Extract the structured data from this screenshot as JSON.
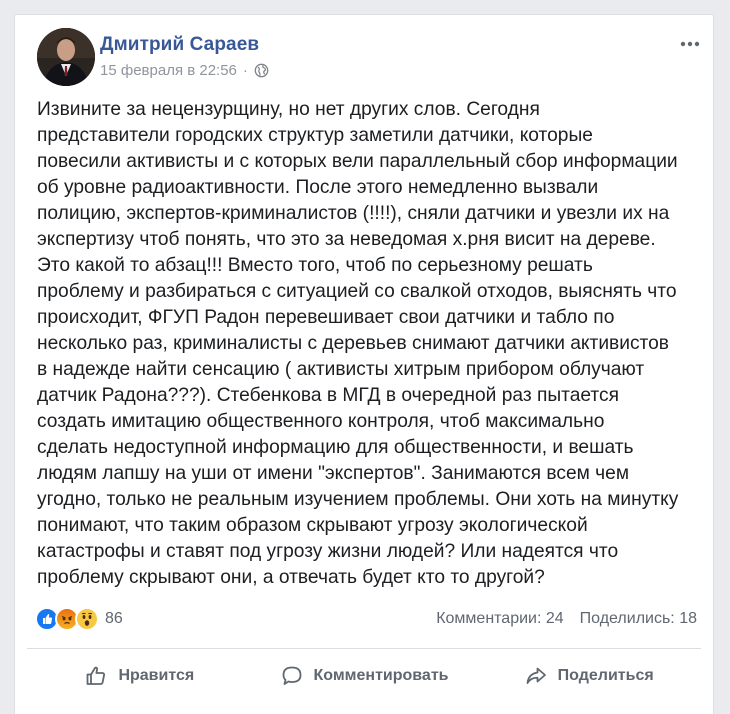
{
  "post": {
    "author": "Дмитрий Сараев",
    "date": "15 февраля в 22:56",
    "separator": "·",
    "privacy_icon": "globe-icon",
    "more_icon": "ellipsis-icon",
    "text": "Извините за нецензурщину, но нет других слов. Сегодня\nпредставители городских структур заметили датчики, которые\nповесили активисты и с которых вели параллельный сбор информации\nоб уровне радиоактивности. После этого немедленно вызвали\nполицию, экспертов-криминалистов (!!!!), сняли датчики и увезли их на\nэкспертизу чтоб понять, что это за неведомая х.рня висит на дереве.\nЭто какой то абзац!!! Вместо того, чтоб по серьезному решать\nпроблему и разбираться с ситуацией со свалкой отходов, выяснять что\nпроисходит, ФГУП Радон перевешивает свои датчики и табло по\nнесколько раз, криминалисты с деревьев снимают датчики активистов\nв надежде найти сенсацию ( активисты хитрым прибором облучают\nдатчик Радона???). Стебенкова в МГД в очередной раз пытается\nсоздать имитацию общественного контроля, чтоб максимально\nсделать недоступной информацию для общественности, и вешать\nлюдям лапшу на уши от имени \"экспертов\". Занимаются всем чем\nугодно, только не реальным изучением проблемы. Они хоть на минутку\nпонимают, что таким образом скрывают угрозу экологической\nкатастрофы и ставят под угрозу жизни людей? Или надеятся что\nпроблему скрывают они, а отвечать будет кто то другой?"
  },
  "reactions": {
    "types": [
      "like",
      "angry",
      "wow"
    ],
    "count": "86"
  },
  "stats": {
    "comments": "Комментарии: 24",
    "shares": "Поделились: 18"
  },
  "actions": {
    "like": "Нравится",
    "comment": "Комментировать",
    "share": "Поделиться"
  },
  "colors": {
    "author": "#385898",
    "meta": "#90949c",
    "like_blue": "#1877f2",
    "angry_orange": "#e9710f",
    "wow_yellow": "#f7b125"
  }
}
